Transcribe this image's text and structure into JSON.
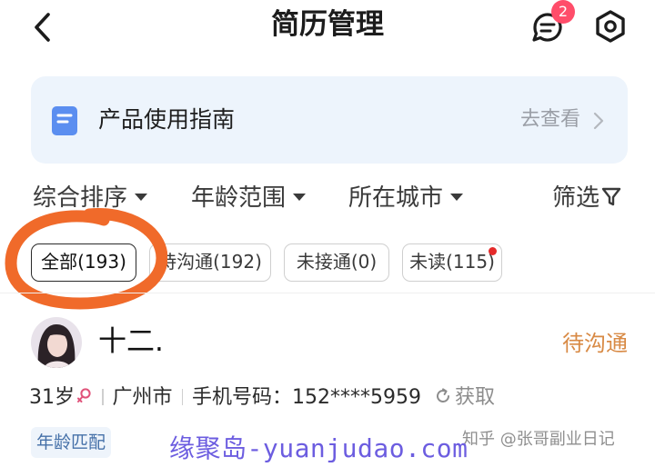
{
  "header": {
    "title": "简历管理",
    "message_badge": "2"
  },
  "guide": {
    "label": "产品使用指南",
    "link": "去查看"
  },
  "filters": {
    "sort": "综合排序",
    "age": "年龄范围",
    "city": "所在城市",
    "filter": "筛选"
  },
  "chips": [
    {
      "label": "全部(193)",
      "selected": true
    },
    {
      "label": "待沟通(192)",
      "selected": false
    },
    {
      "label": "未接通(0)",
      "selected": false
    },
    {
      "label": "未读(115)",
      "selected": false,
      "unread_dot": true
    }
  ],
  "candidate": {
    "name": "十二.",
    "status": "待沟通",
    "age": "31岁",
    "gender_icon": "female-icon",
    "city": "广州市",
    "phone_label": "手机号码：",
    "phone": "152****5959",
    "fetch": "获取",
    "tag": "年龄匹配"
  },
  "watermarks": {
    "zhihu": "知乎 @张哥副业日记",
    "site": "缘聚岛-yuanjudao.com"
  },
  "colors": {
    "accent_status": "#d88a45",
    "badge": "#ff4d6a",
    "banner_bg": "#edf4fc",
    "tag_text": "#4570a8",
    "highlight_ring": "#f06a2a",
    "watermark": "#6c5de0"
  }
}
